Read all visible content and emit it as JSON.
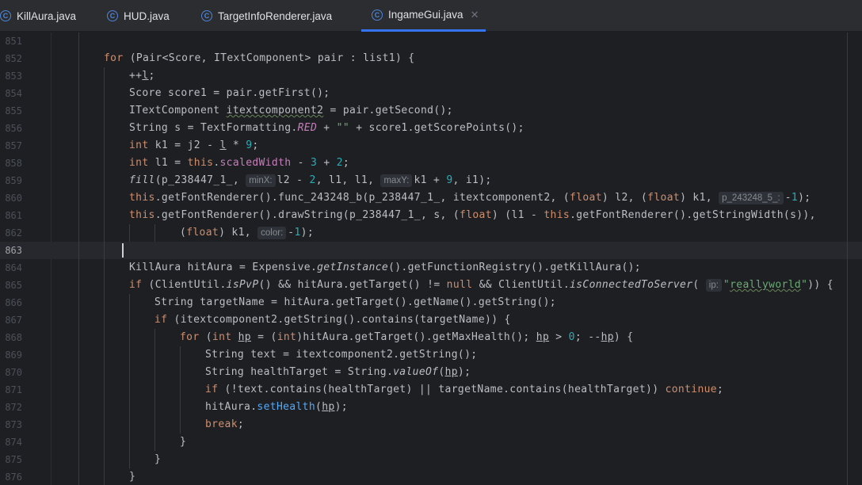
{
  "tabs": [
    {
      "label": "KillAura.java",
      "active": false
    },
    {
      "label": "HUD.java",
      "active": false
    },
    {
      "label": "TargetInfoRenderer.java",
      "active": false
    },
    {
      "label": "IngameGui.java",
      "active": true
    }
  ],
  "tab_icon_letter": "C",
  "close_glyph": "✕",
  "current_line": 863,
  "lines": [
    {
      "num": "851",
      "indent": 2,
      "parts": []
    },
    {
      "num": "852",
      "indent": 2,
      "parts": [
        [
          "kw",
          "for"
        ],
        [
          "t",
          " (Pair<Score, ITextComponent> pair : list1) {"
        ]
      ]
    },
    {
      "num": "853",
      "indent": 3,
      "parts": [
        [
          "t",
          "++"
        ],
        [
          "ul",
          "l"
        ],
        [
          "t",
          ";"
        ]
      ]
    },
    {
      "num": "854",
      "indent": 3,
      "parts": [
        [
          "t",
          "Score score1 = pair.getFirst();"
        ]
      ]
    },
    {
      "num": "855",
      "indent": 3,
      "parts": [
        [
          "t",
          "ITextComponent "
        ],
        [
          "wavy",
          "itextcomponent2"
        ],
        [
          "t",
          " = pair.getSecond();"
        ]
      ]
    },
    {
      "num": "856",
      "indent": 3,
      "parts": [
        [
          "t",
          "String s = TextFormatting."
        ],
        [
          "sfld",
          "RED"
        ],
        [
          "t",
          " + "
        ],
        [
          "str",
          "\"\""
        ],
        [
          "t",
          " + score1.getScorePoints();"
        ]
      ]
    },
    {
      "num": "857",
      "indent": 3,
      "parts": [
        [
          "kw",
          "int"
        ],
        [
          "t",
          " k1 = j2 - "
        ],
        [
          "ul",
          "l"
        ],
        [
          "t",
          " * "
        ],
        [
          "num",
          "9"
        ],
        [
          "t",
          ";"
        ]
      ]
    },
    {
      "num": "858",
      "indent": 3,
      "parts": [
        [
          "kw",
          "int"
        ],
        [
          "t",
          " l1 = "
        ],
        [
          "kw",
          "this"
        ],
        [
          "t",
          "."
        ],
        [
          "fld",
          "scaledWidth"
        ],
        [
          "t",
          " - "
        ],
        [
          "num",
          "3"
        ],
        [
          "t",
          " + "
        ],
        [
          "num",
          "2"
        ],
        [
          "t",
          ";"
        ]
      ]
    },
    {
      "num": "859",
      "indent": 3,
      "parts": [
        [
          "smeth",
          "fill"
        ],
        [
          "t",
          "(p_238447_1_, "
        ],
        [
          "hint",
          "minX:"
        ],
        [
          "t",
          "l2 - "
        ],
        [
          "num",
          "2"
        ],
        [
          "t",
          ", l1, l1, "
        ],
        [
          "hint",
          "maxY:"
        ],
        [
          "t",
          "k1 + "
        ],
        [
          "num",
          "9"
        ],
        [
          "t",
          ", i1);"
        ]
      ]
    },
    {
      "num": "860",
      "indent": 3,
      "parts": [
        [
          "kw",
          "this"
        ],
        [
          "t",
          ".getFontRenderer().func_243248_b(p_238447_1_, itextcomponent2, ("
        ],
        [
          "kw",
          "float"
        ],
        [
          "t",
          ") l2, ("
        ],
        [
          "kw",
          "float"
        ],
        [
          "t",
          ") k1, "
        ],
        [
          "hint",
          "p_243248_5_:"
        ],
        [
          "t",
          "-"
        ],
        [
          "num",
          "1"
        ],
        [
          "t",
          ");"
        ]
      ]
    },
    {
      "num": "861",
      "indent": 3,
      "parts": [
        [
          "kw",
          "this"
        ],
        [
          "t",
          ".getFontRenderer().drawString(p_238447_1_, s, ("
        ],
        [
          "kw",
          "float"
        ],
        [
          "t",
          ") (l1 - "
        ],
        [
          "kw",
          "this"
        ],
        [
          "t",
          ".getFontRenderer().getStringWidth(s)),"
        ]
      ]
    },
    {
      "num": "862",
      "indent": 5,
      "parts": [
        [
          "t",
          "("
        ],
        [
          "kw",
          "float"
        ],
        [
          "t",
          ") k1, "
        ],
        [
          "hint",
          "color:"
        ],
        [
          "t",
          "-"
        ],
        [
          "num",
          "1"
        ],
        [
          "t",
          ");"
        ]
      ]
    },
    {
      "num": "863",
      "indent": 3,
      "parts": []
    },
    {
      "num": "864",
      "indent": 3,
      "parts": [
        [
          "t",
          "KillAura hitAura = Expensive."
        ],
        [
          "smeth",
          "getInstance"
        ],
        [
          "t",
          "().getFunctionRegistry().getKillAura();"
        ]
      ]
    },
    {
      "num": "865",
      "indent": 3,
      "parts": [
        [
          "kw",
          "if"
        ],
        [
          "t",
          " (ClientUtil."
        ],
        [
          "smeth",
          "isPvP"
        ],
        [
          "t",
          "() && hitAura.getTarget() != "
        ],
        [
          "kw",
          "null"
        ],
        [
          "t",
          " && ClientUtil."
        ],
        [
          "smeth",
          "isConnectedToServer"
        ],
        [
          "t",
          "( "
        ],
        [
          "hint",
          "ip:"
        ],
        [
          "str",
          "\""
        ],
        [
          "strwavy",
          "reallyworld"
        ],
        [
          "str",
          "\""
        ],
        [
          "t",
          "))"
        ],
        [
          "t",
          " {"
        ]
      ]
    },
    {
      "num": "866",
      "indent": 4,
      "parts": [
        [
          "t",
          "String targetName = hitAura.getTarget().getName().getString();"
        ]
      ]
    },
    {
      "num": "867",
      "indent": 4,
      "parts": [
        [
          "kw",
          "if"
        ],
        [
          "t",
          " (itextcomponent2.getString().contains(targetName)) {"
        ]
      ]
    },
    {
      "num": "868",
      "indent": 5,
      "parts": [
        [
          "kw",
          "for"
        ],
        [
          "t",
          " ("
        ],
        [
          "kw",
          "int"
        ],
        [
          "t",
          " "
        ],
        [
          "ul",
          "hp"
        ],
        [
          "t",
          " = ("
        ],
        [
          "kw",
          "int"
        ],
        [
          "t",
          ")hitAura.getTarget().getMaxHealth(); "
        ],
        [
          "ul",
          "hp"
        ],
        [
          "t",
          " > "
        ],
        [
          "num",
          "0"
        ],
        [
          "t",
          "; --"
        ],
        [
          "ul",
          "hp"
        ],
        [
          "t",
          ") {"
        ]
      ]
    },
    {
      "num": "869",
      "indent": 6,
      "parts": [
        [
          "t",
          "String text = itextcomponent2.getString();"
        ]
      ]
    },
    {
      "num": "870",
      "indent": 6,
      "parts": [
        [
          "t",
          "String healthTarget = String."
        ],
        [
          "smeth",
          "valueOf"
        ],
        [
          "t",
          "("
        ],
        [
          "ul",
          "hp"
        ],
        [
          "t",
          ");"
        ]
      ]
    },
    {
      "num": "871",
      "indent": 6,
      "parts": [
        [
          "kw",
          "if"
        ],
        [
          "t",
          " (!text.contains(healthTarget) || targetName.contains(healthTarget)) "
        ],
        [
          "kw",
          "continue"
        ],
        [
          "t",
          ";"
        ]
      ]
    },
    {
      "num": "872",
      "indent": 6,
      "parts": [
        [
          "t",
          "hitAura."
        ],
        [
          "mcall",
          "setHealth"
        ],
        [
          "t",
          "("
        ],
        [
          "ul",
          "hp"
        ],
        [
          "t",
          ");"
        ]
      ]
    },
    {
      "num": "873",
      "indent": 6,
      "parts": [
        [
          "kw",
          "break"
        ],
        [
          "t",
          ";"
        ]
      ]
    },
    {
      "num": "874",
      "indent": 5,
      "parts": [
        [
          "t",
          "}"
        ]
      ]
    },
    {
      "num": "875",
      "indent": 4,
      "parts": [
        [
          "t",
          "}"
        ]
      ]
    },
    {
      "num": "876",
      "indent": 3,
      "parts": [
        [
          "t",
          "}"
        ]
      ]
    }
  ]
}
